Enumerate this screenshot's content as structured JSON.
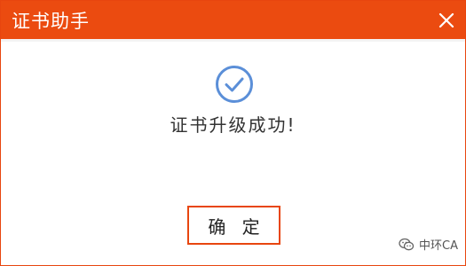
{
  "window": {
    "title": "证书助手",
    "close_icon": "close-icon",
    "accent_color": "#eb4b10"
  },
  "dialog": {
    "status_icon": "checkmark-circle-icon",
    "status_color": "#5b8fd8",
    "message": "证书升级成功!",
    "ok_label": "确  定"
  },
  "watermark": {
    "icon": "wechat-icon",
    "text": "中环CA"
  }
}
